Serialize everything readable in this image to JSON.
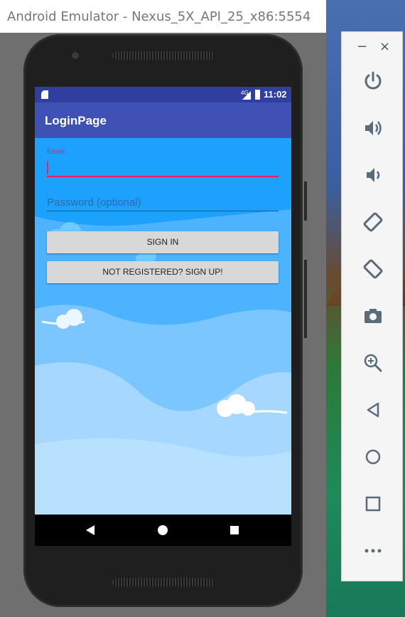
{
  "window": {
    "title": "Android Emulator - Nexus_5X_API_25_x86:5554"
  },
  "statusbar": {
    "network": "4G",
    "time": "11:02"
  },
  "appbar": {
    "title": "LoginPage"
  },
  "form": {
    "email_label": "Email",
    "email_value": "",
    "password_placeholder": "Password (optional)",
    "password_value": "",
    "sign_in_label": "SIGN IN",
    "sign_up_label": "NOT REGISTERED? SIGN UP!"
  },
  "toolbar": {
    "minimize": "−",
    "close": "×",
    "items": [
      "power-icon",
      "volume-up-icon",
      "volume-down-icon",
      "rotate-left-icon",
      "rotate-right-icon",
      "camera-icon",
      "zoom-icon",
      "back-icon",
      "home-icon",
      "overview-icon",
      "more-icon"
    ]
  },
  "colors": {
    "appbar": "#3f51b5",
    "statusbar": "#303f9f",
    "accent": "#e91e63",
    "screen_bg": "#1da1ff"
  }
}
